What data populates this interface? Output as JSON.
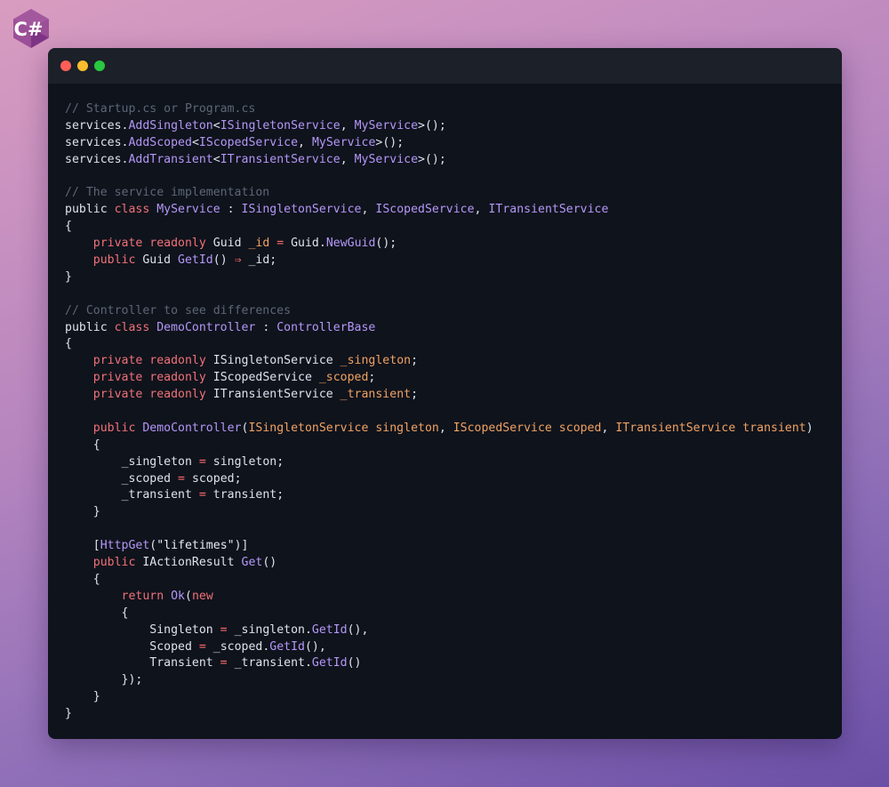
{
  "logo": {
    "text": "C#",
    "color": "#9b4f96"
  },
  "window": {
    "buttons": [
      "close",
      "minimize",
      "maximize"
    ]
  },
  "colors": {
    "background": "#0f131c",
    "comment": "#5d6676",
    "keyword": "#f07178",
    "type": "#b497f7",
    "parameter": "#f0a262",
    "plain": "#dde3ee"
  },
  "code_lines": [
    [
      [
        "c",
        "// Startup.cs or Program.cs"
      ]
    ],
    [
      [
        "p",
        "services."
      ],
      [
        "t",
        "AddSingleton"
      ],
      [
        "p",
        "<"
      ],
      [
        "t",
        "ISingletonService"
      ],
      [
        "p",
        ", "
      ],
      [
        "t",
        "MyService"
      ],
      [
        "p",
        ">();"
      ]
    ],
    [
      [
        "p",
        "services."
      ],
      [
        "t",
        "AddScoped"
      ],
      [
        "p",
        "<"
      ],
      [
        "t",
        "IScopedService"
      ],
      [
        "p",
        ", "
      ],
      [
        "t",
        "MyService"
      ],
      [
        "p",
        ">();"
      ]
    ],
    [
      [
        "p",
        "services."
      ],
      [
        "t",
        "AddTransient"
      ],
      [
        "p",
        "<"
      ],
      [
        "t",
        "ITransientService"
      ],
      [
        "p",
        ", "
      ],
      [
        "t",
        "MyService"
      ],
      [
        "p",
        ">();"
      ]
    ],
    [],
    [
      [
        "c",
        "// The service implementation"
      ]
    ],
    [
      [
        "p",
        "public "
      ],
      [
        "k",
        "class "
      ],
      [
        "t",
        "MyService"
      ],
      [
        "p",
        " : "
      ],
      [
        "t",
        "ISingletonService"
      ],
      [
        "p",
        ", "
      ],
      [
        "t",
        "IScopedService"
      ],
      [
        "p",
        ", "
      ],
      [
        "t",
        "ITransientService"
      ]
    ],
    [
      [
        "p",
        "{"
      ]
    ],
    [
      [
        "p",
        "    "
      ],
      [
        "k",
        "private readonly "
      ],
      [
        "p",
        "Guid "
      ],
      [
        "a",
        "_id"
      ],
      [
        "o",
        " = "
      ],
      [
        "p",
        "Guid."
      ],
      [
        "t",
        "NewGuid"
      ],
      [
        "p",
        "();"
      ]
    ],
    [
      [
        "p",
        "    "
      ],
      [
        "k",
        "public "
      ],
      [
        "p",
        "Guid "
      ],
      [
        "t",
        "GetId"
      ],
      [
        "p",
        "() "
      ],
      [
        "o",
        "⇒"
      ],
      [
        "p",
        " _id;"
      ]
    ],
    [
      [
        "p",
        "}"
      ]
    ],
    [],
    [
      [
        "c",
        "// Controller to see differences"
      ]
    ],
    [
      [
        "p",
        "public "
      ],
      [
        "k",
        "class "
      ],
      [
        "t",
        "DemoController"
      ],
      [
        "p",
        " : "
      ],
      [
        "t",
        "ControllerBase"
      ]
    ],
    [
      [
        "p",
        "{"
      ]
    ],
    [
      [
        "p",
        "    "
      ],
      [
        "k",
        "private readonly "
      ],
      [
        "p",
        "ISingletonService "
      ],
      [
        "a",
        "_singleton"
      ],
      [
        "p",
        ";"
      ]
    ],
    [
      [
        "p",
        "    "
      ],
      [
        "k",
        "private readonly "
      ],
      [
        "p",
        "IScopedService "
      ],
      [
        "a",
        "_scoped"
      ],
      [
        "p",
        ";"
      ]
    ],
    [
      [
        "p",
        "    "
      ],
      [
        "k",
        "private readonly "
      ],
      [
        "p",
        "ITransientService "
      ],
      [
        "a",
        "_transient"
      ],
      [
        "p",
        ";"
      ]
    ],
    [],
    [
      [
        "p",
        "    "
      ],
      [
        "k",
        "public "
      ],
      [
        "t",
        "DemoController"
      ],
      [
        "p",
        "("
      ],
      [
        "a",
        "ISingletonService singleton"
      ],
      [
        "p",
        ", "
      ],
      [
        "a",
        "IScopedService scoped"
      ],
      [
        "p",
        ", "
      ],
      [
        "a",
        "ITransientService transient"
      ],
      [
        "p",
        ")"
      ]
    ],
    [
      [
        "p",
        "    {"
      ]
    ],
    [
      [
        "p",
        "        _singleton "
      ],
      [
        "o",
        "="
      ],
      [
        "p",
        " singleton;"
      ]
    ],
    [
      [
        "p",
        "        _scoped "
      ],
      [
        "o",
        "="
      ],
      [
        "p",
        " scoped;"
      ]
    ],
    [
      [
        "p",
        "        _transient "
      ],
      [
        "o",
        "="
      ],
      [
        "p",
        " transient;"
      ]
    ],
    [
      [
        "p",
        "    }"
      ]
    ],
    [],
    [
      [
        "p",
        "    ["
      ],
      [
        "t",
        "HttpGet"
      ],
      [
        "p",
        "("
      ],
      [
        "s",
        "\"lifetimes\""
      ],
      [
        "p",
        ")]"
      ]
    ],
    [
      [
        "p",
        "    "
      ],
      [
        "k",
        "public "
      ],
      [
        "p",
        "IActionResult "
      ],
      [
        "t",
        "Get"
      ],
      [
        "p",
        "()"
      ]
    ],
    [
      [
        "p",
        "    {"
      ]
    ],
    [
      [
        "p",
        "        "
      ],
      [
        "k",
        "return "
      ],
      [
        "t",
        "Ok"
      ],
      [
        "p",
        "("
      ],
      [
        "k",
        "new"
      ]
    ],
    [
      [
        "p",
        "        {"
      ]
    ],
    [
      [
        "p",
        "            Singleton "
      ],
      [
        "o",
        "="
      ],
      [
        "p",
        " _singleton."
      ],
      [
        "t",
        "GetId"
      ],
      [
        "p",
        "(),"
      ]
    ],
    [
      [
        "p",
        "            Scoped "
      ],
      [
        "o",
        "="
      ],
      [
        "p",
        " _scoped."
      ],
      [
        "t",
        "GetId"
      ],
      [
        "p",
        "(),"
      ]
    ],
    [
      [
        "p",
        "            Transient "
      ],
      [
        "o",
        "="
      ],
      [
        "p",
        " _transient."
      ],
      [
        "t",
        "GetId"
      ],
      [
        "p",
        "()"
      ]
    ],
    [
      [
        "p",
        "        });"
      ]
    ],
    [
      [
        "p",
        "    }"
      ]
    ],
    [
      [
        "p",
        "}"
      ]
    ]
  ]
}
